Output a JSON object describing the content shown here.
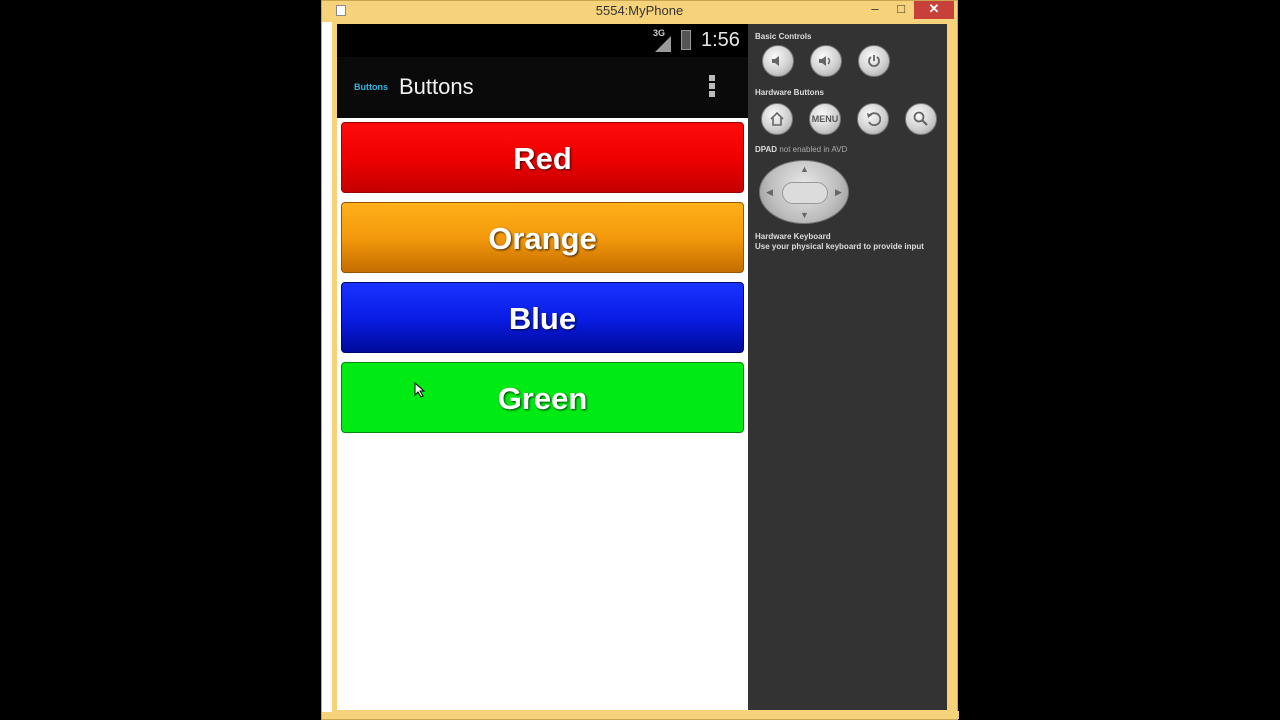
{
  "window": {
    "title": "5554:MyPhone",
    "minimize_label": "–",
    "maximize_label": "□",
    "close_label": "✕"
  },
  "statusbar": {
    "network": "3G",
    "time": "1:56"
  },
  "actionbar": {
    "icon_text": "Buttons",
    "title": "Buttons"
  },
  "buttons": [
    {
      "label": "Red",
      "color": "#f00000"
    },
    {
      "label": "Orange",
      "color": "#f39a0c"
    },
    {
      "label": "Blue",
      "color": "#0a1de6"
    },
    {
      "label": "Green",
      "color": "#00ea14"
    }
  ],
  "controls": {
    "basic_heading": "Basic Controls",
    "hardware_heading": "Hardware Buttons",
    "menu_label": "MENU",
    "dpad_heading": "DPAD",
    "dpad_note": "not enabled in AVD",
    "keyboard_heading": "Hardware Keyboard",
    "keyboard_note": "Use your physical keyboard to provide input"
  },
  "icons": [
    "volume-down-icon",
    "volume-up-icon",
    "power-icon",
    "home-icon",
    "back-icon",
    "search-icon",
    "overflow-menu-icon",
    "signal-icon",
    "battery-icon"
  ]
}
